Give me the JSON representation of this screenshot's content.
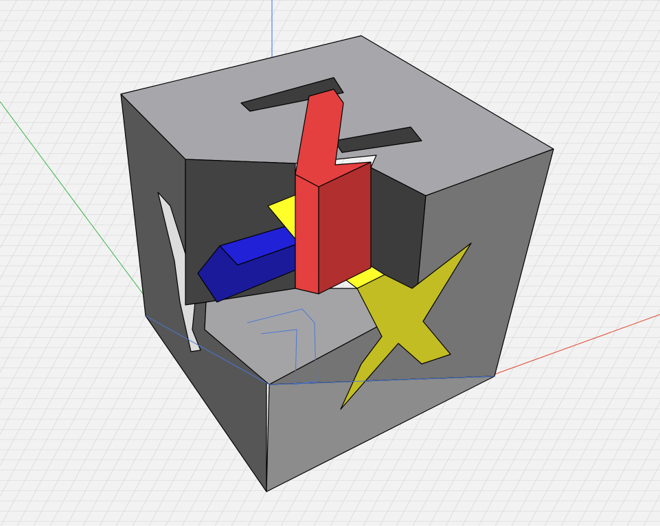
{
  "viewport": {
    "scene": "3d-cad-axis-calibration-cube",
    "background": "#f2f2f2",
    "grid": {
      "visible": true,
      "minor_color": "#cfcfcf",
      "major_color": "#b9b9b9"
    },
    "axes": {
      "x_color": "#e0442c",
      "y_color": "#39b34a",
      "z_color": "#2b6fff"
    }
  },
  "colors": {
    "face_top": "#a7a6aa",
    "face_left": "#565656",
    "face_right": "#747474",
    "face_front": "#8c8c8c",
    "inner_dark": "#424242",
    "inner_floor": "#a4a4a6",
    "letter_z": "#e4403f",
    "letter_z_side": "#b12f2f",
    "letter_x": "#c2bd23",
    "letter_x_top": "#ffff2a",
    "letter_y": "#2121d8",
    "letter_y_side": "#1a1a9a",
    "letter_y_cut": "#d9d9d9"
  }
}
